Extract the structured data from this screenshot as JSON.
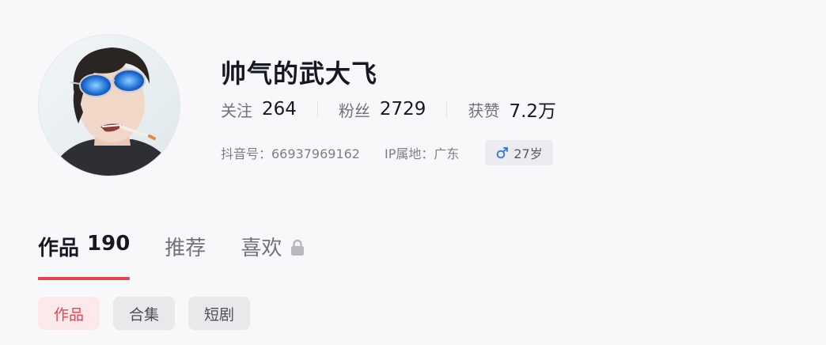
{
  "profile": {
    "nickname": "帅气的武大飞",
    "stats": [
      {
        "label": "关注",
        "value": "264"
      },
      {
        "label": "粉丝",
        "value": "2729"
      },
      {
        "label": "获赞",
        "value": "7.2万"
      }
    ],
    "meta": {
      "douyin_id": "抖音号：66937969162",
      "ip_location": "IP属地：广东",
      "age": "27岁",
      "gender_icon": "male-icon"
    }
  },
  "tabs": [
    {
      "label": "作品",
      "count": "190",
      "active": true
    },
    {
      "label": "推荐",
      "active": false
    },
    {
      "label": "喜欢",
      "locked": true,
      "active": false
    }
  ],
  "sub_tabs": [
    {
      "label": "作品",
      "active": true
    },
    {
      "label": "合集",
      "active": false
    },
    {
      "label": "短剧",
      "active": false
    }
  ],
  "colors": {
    "accent": "#e64553",
    "gender_male": "#3a7de0",
    "background": "#f8f8fa"
  }
}
